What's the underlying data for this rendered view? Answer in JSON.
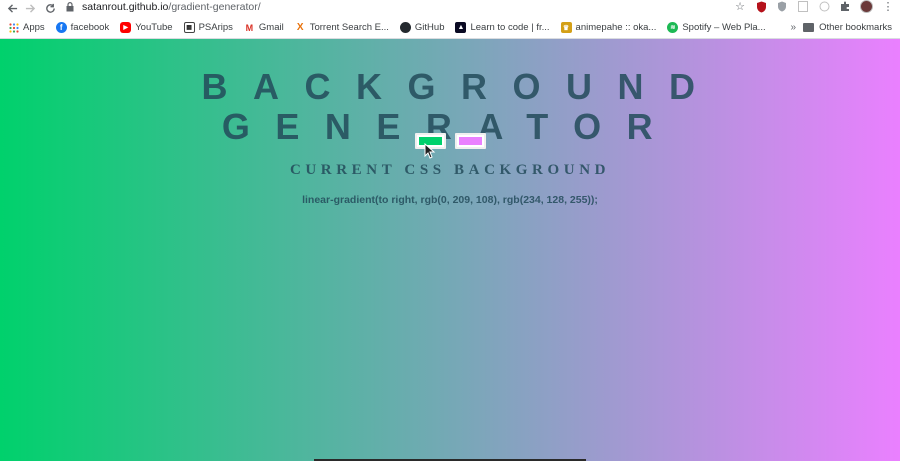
{
  "browser": {
    "url_host": "satanrout.github.io",
    "url_path": "/gradient-generator/",
    "bookmarks": [
      {
        "label": "Apps",
        "icon": "apps-grid-icon",
        "color": "#ea4335"
      },
      {
        "label": "facebook",
        "icon": "facebook-icon",
        "color": "#1877f2"
      },
      {
        "label": "YouTube",
        "icon": "youtube-icon",
        "color": "#ff0000"
      },
      {
        "label": "PSArips",
        "icon": "psarips-icon",
        "color": "#444444"
      },
      {
        "label": "Gmail",
        "icon": "gmail-icon",
        "color": "#d93025"
      },
      {
        "label": "Torrent Search E...",
        "icon": "torrent-x-icon",
        "color": "#e8710a"
      },
      {
        "label": "GitHub",
        "icon": "github-icon",
        "color": "#24292e"
      },
      {
        "label": "Learn to code | fr...",
        "icon": "freecodecamp-icon",
        "color": "#0a0a23"
      },
      {
        "label": "animepahe :: oka...",
        "icon": "animepahe-icon",
        "color": "#d4a017"
      },
      {
        "label": "Spotify – Web Pla...",
        "icon": "spotify-icon",
        "color": "#1db954"
      }
    ],
    "more_label": "»",
    "other_bookmarks_label": "Other bookmarks"
  },
  "page": {
    "title": "BACKGROUND GENERATOR",
    "subtitle": "CURRENT CSS BACKGROUND",
    "css_output": "linear-gradient(to right, rgb(0, 209, 108), rgb(234, 128, 255));",
    "color1": "#00d16c",
    "color2": "#ea80ff",
    "gradient_direction": "to right"
  }
}
